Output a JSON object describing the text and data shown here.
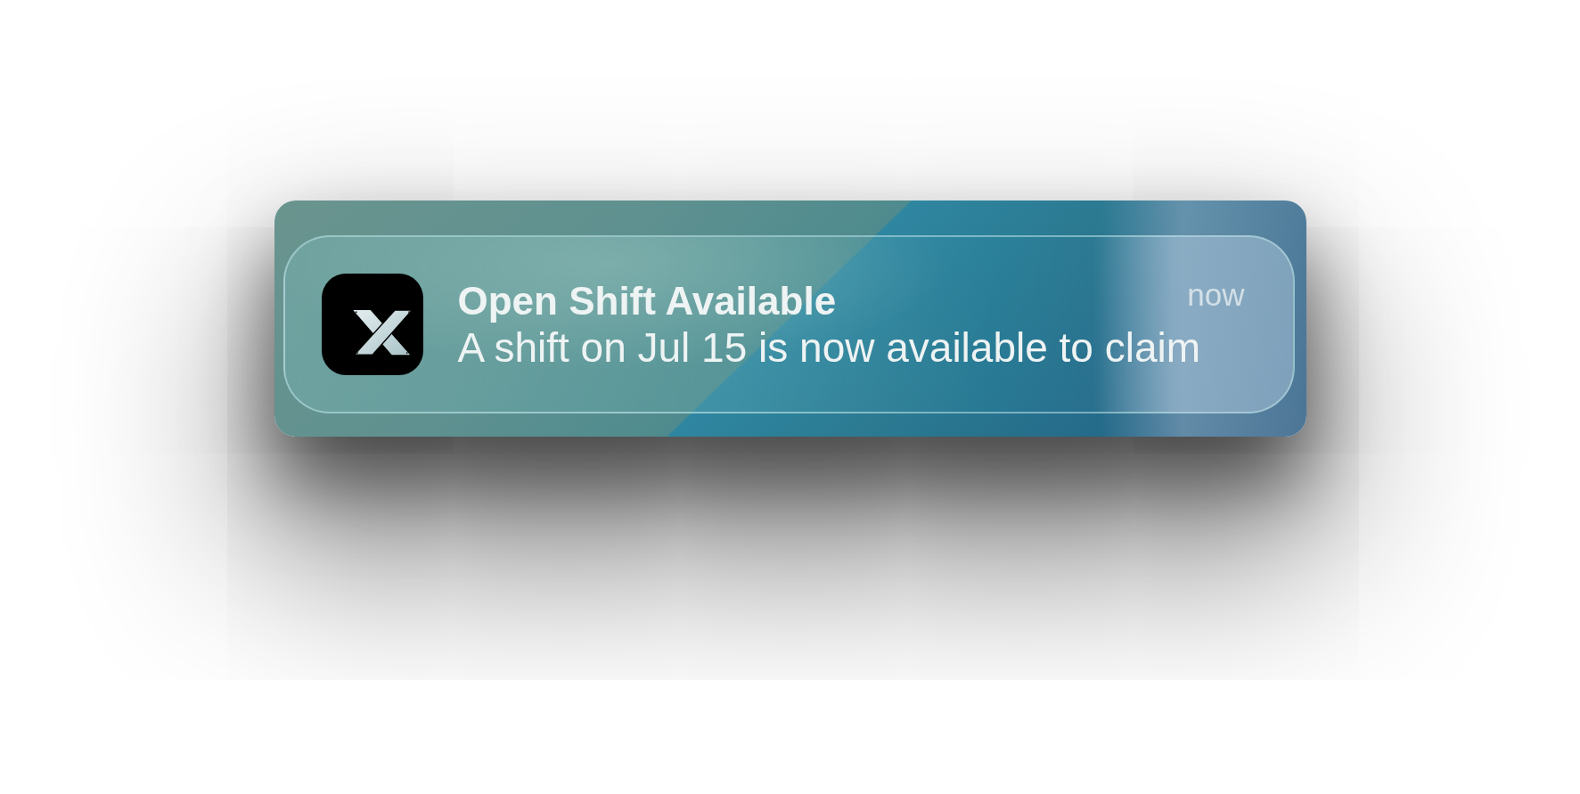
{
  "notification": {
    "title": "Open Shift Available",
    "message": "A shift on Jul 15 is now available to claim",
    "time": "now"
  }
}
